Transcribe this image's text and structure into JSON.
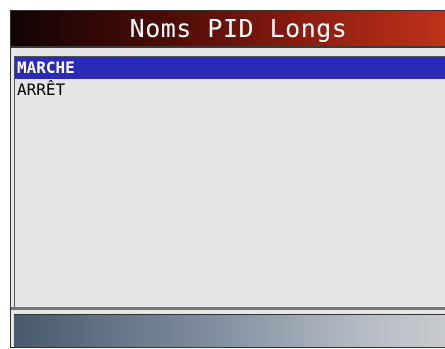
{
  "screen": {
    "title": "Noms PID Longs"
  },
  "menu": {
    "items": [
      {
        "label": "MARCHE",
        "selected": true
      },
      {
        "label": "ARRÊT",
        "selected": false
      }
    ]
  },
  "colors": {
    "title_gradient_start": "#120404",
    "title_gradient_end": "#c0331a",
    "selection_bg": "#2a2ab8",
    "list_bg": "#e6e6e6"
  }
}
